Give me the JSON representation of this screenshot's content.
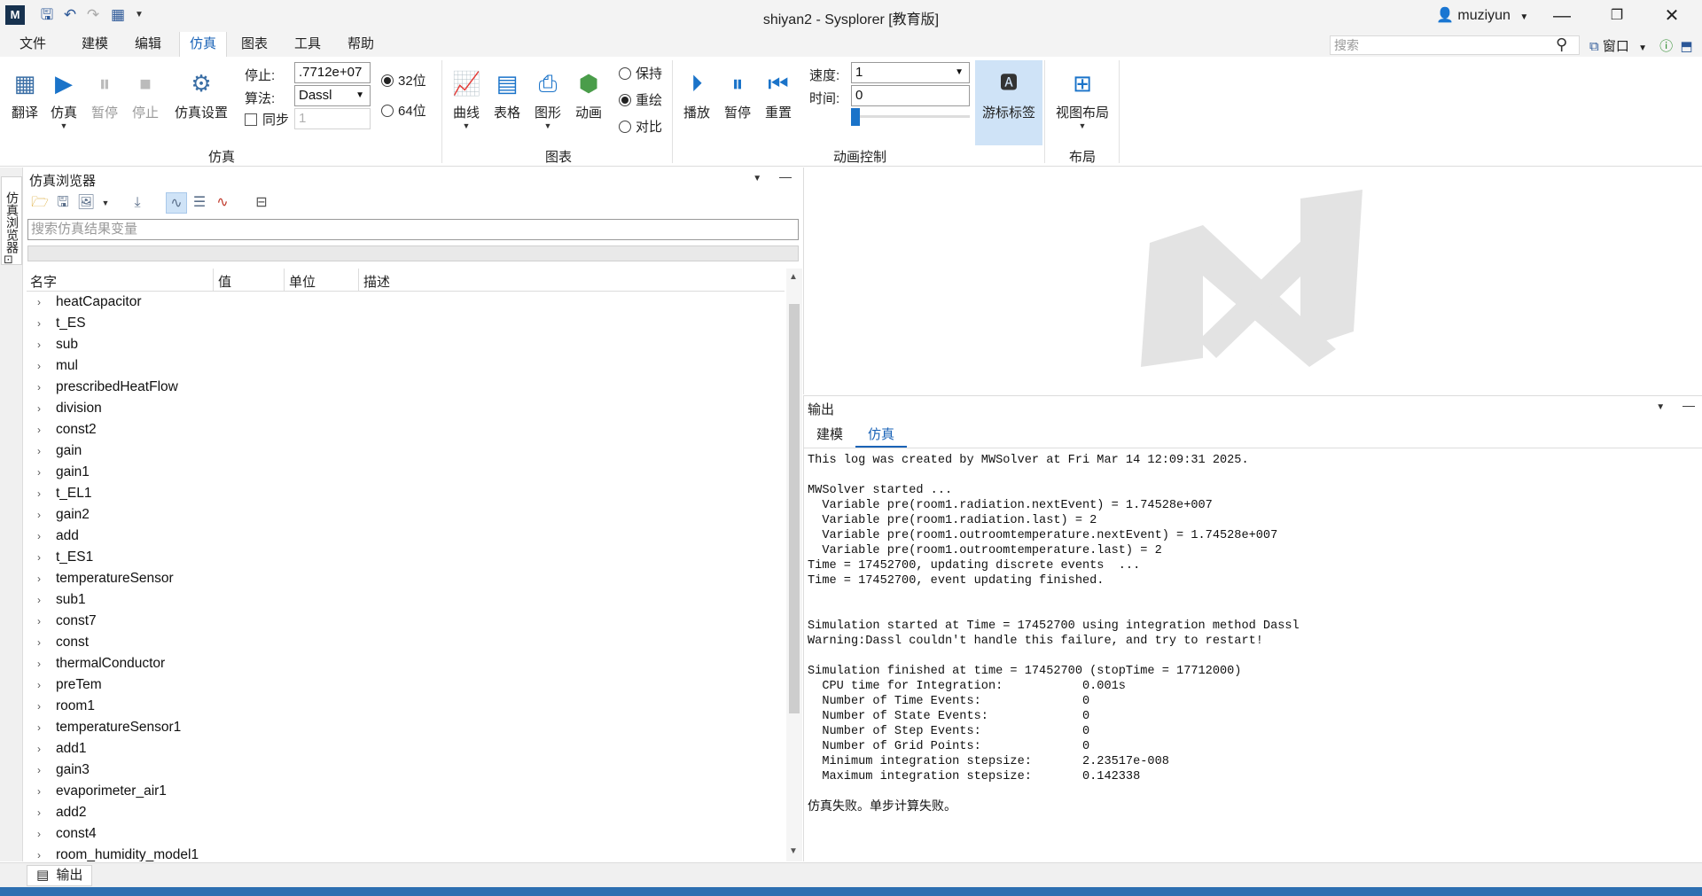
{
  "titlebar": {
    "window_title": "shiyan2 - Sysplorer [教育版]",
    "user": "muziyun",
    "logo": "M"
  },
  "menubar": {
    "items": [
      "文件",
      "建模",
      "编辑",
      "仿真",
      "图表",
      "工具",
      "帮助"
    ],
    "active": "仿真",
    "search_placeholder": "搜索",
    "window_menu": "窗口"
  },
  "ribbon": {
    "sim_buttons": {
      "translate": "翻译",
      "simulate": "仿真",
      "pause": "暂停",
      "stop": "停止",
      "settings": "仿真设置"
    },
    "stop_label": "停止:",
    "stop_value": ".7712e+07",
    "algo_label": "算法:",
    "algo_value": "Dassl",
    "sync_label": "同步",
    "sync_value": "1",
    "bit32": "32位",
    "bit64": "64位",
    "group_sim": "仿真",
    "chart_buttons": {
      "curve": "曲线",
      "table": "表格",
      "graphic": "图形",
      "animation": "动画"
    },
    "keep": "保持",
    "redraw": "重绘",
    "compare": "对比",
    "group_chart": "图表",
    "anim_buttons": {
      "play": "播放",
      "pause": "暂停",
      "reset": "重置"
    },
    "speed_label": "速度:",
    "speed_value": "1",
    "time_label": "时间:",
    "time_value": "0",
    "cursor_label": "游标标签",
    "group_anim": "动画控制",
    "view_layout": "视图布局",
    "group_layout": "布局"
  },
  "side_tab": "仿真浏览器",
  "browser": {
    "title": "仿真浏览器",
    "search_placeholder": "搜索仿真结果变量",
    "columns": [
      "名字",
      "值",
      "单位",
      "描述"
    ],
    "items": [
      "heatCapacitor",
      "t_ES",
      "sub",
      "mul",
      "prescribedHeatFlow",
      "division",
      "const2",
      "gain",
      "gain1",
      "t_EL1",
      "gain2",
      "add",
      "t_ES1",
      "temperatureSensor",
      "sub1",
      "const7",
      "const",
      "thermalConductor",
      "preTem",
      "room1",
      "temperatureSensor1",
      "add1",
      "gain3",
      "evaporimeter_air1",
      "add2",
      "const4",
      "room_humidity_model1"
    ]
  },
  "output": {
    "title": "输出",
    "tabs": [
      "建模",
      "仿真"
    ],
    "active_tab": "仿真",
    "log_lines": [
      "This log was created by MWSolver at Fri Mar 14 12:09:31 2025.",
      "",
      "MWSolver started ...",
      "  Variable pre(room1.radiation.nextEvent) = 1.74528e+007",
      "  Variable pre(room1.radiation.last) = 2",
      "  Variable pre(room1.outroomtemperature.nextEvent) = 1.74528e+007",
      "  Variable pre(room1.outroomtemperature.last) = 2",
      "Time = 17452700, updating discrete events  ...",
      "Time = 17452700, event updating finished.",
      "",
      "",
      "Simulation started at Time = 17452700 using integration method Dassl",
      "Warning:Dassl couldn't handle this failure, and try to restart!",
      "",
      "Simulation finished at time = 17452700 (stopTime = 17712000)",
      "  CPU time for Integration:           0.001s",
      "  Number of Time Events:              0",
      "  Number of State Events:             0",
      "  Number of Step Events:              0",
      "  Number of Grid Points:              0",
      "  Minimum integration stepsize:       2.23517e-008",
      "  Maximum integration stepsize:       0.142338"
    ],
    "final_message": "仿真失败。单步计算失败。"
  },
  "bottom_dock": {
    "output_tab": "输出"
  },
  "colors": {
    "accent": "#1a63b7",
    "status_bar": "#2d6fb1",
    "selected_button_bg": "#cfe3f7"
  }
}
